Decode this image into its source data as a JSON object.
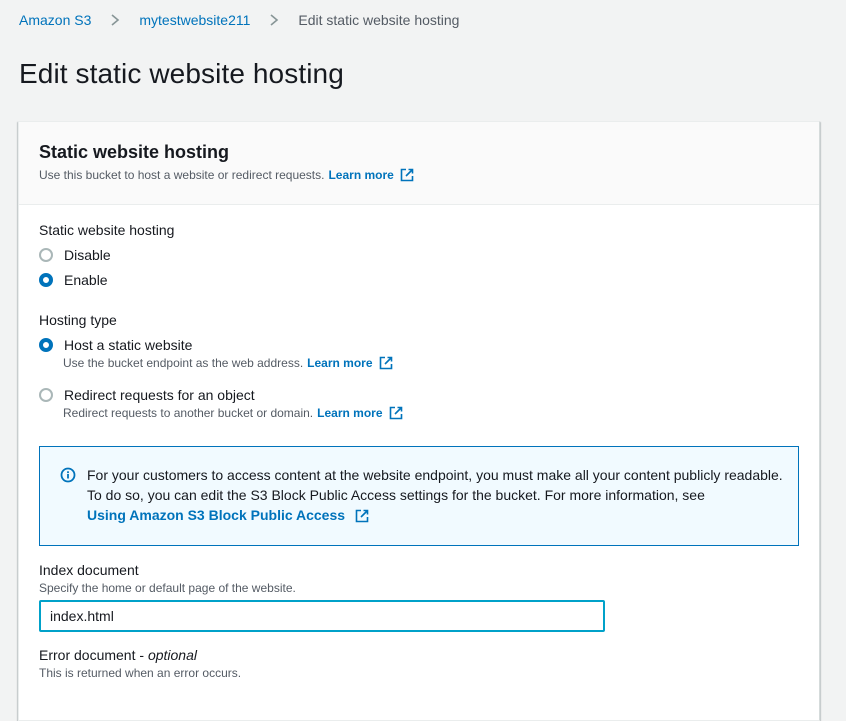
{
  "breadcrumb": {
    "items": [
      "Amazon S3",
      "mytestwebsite211"
    ],
    "current": "Edit static website hosting"
  },
  "page_title": "Edit static website hosting",
  "panel": {
    "title": "Static website hosting",
    "description": "Use this bucket to host a website or redirect requests.",
    "learn_more": "Learn more"
  },
  "hosting": {
    "label": "Static website hosting",
    "options": [
      {
        "label": "Disable",
        "selected": false
      },
      {
        "label": "Enable",
        "selected": true
      }
    ]
  },
  "hosting_type": {
    "label": "Hosting type",
    "options": [
      {
        "label": "Host a static website",
        "description": "Use the bucket endpoint as the web address.",
        "learn_more": "Learn more",
        "selected": true
      },
      {
        "label": "Redirect requests for an object",
        "description": "Redirect requests to another bucket or domain.",
        "learn_more": "Learn more",
        "selected": false
      }
    ]
  },
  "info": {
    "text": "For your customers to access content at the website endpoint, you must make all your content publicly readable. To do so, you can edit the S3 Block Public Access settings for the bucket. For more information, see",
    "link": "Using Amazon S3 Block Public Access"
  },
  "index_document": {
    "label": "Index document",
    "description": "Specify the home or default page of the website.",
    "value": "index.html"
  },
  "error_document": {
    "label": "Error document - ",
    "optional": "optional",
    "description": "This is returned when an error occurs."
  },
  "colors": {
    "link": "#0073bb",
    "background": "#f2f3f3",
    "info_bg": "#f1faff",
    "input_focus": "#00a1c9"
  }
}
